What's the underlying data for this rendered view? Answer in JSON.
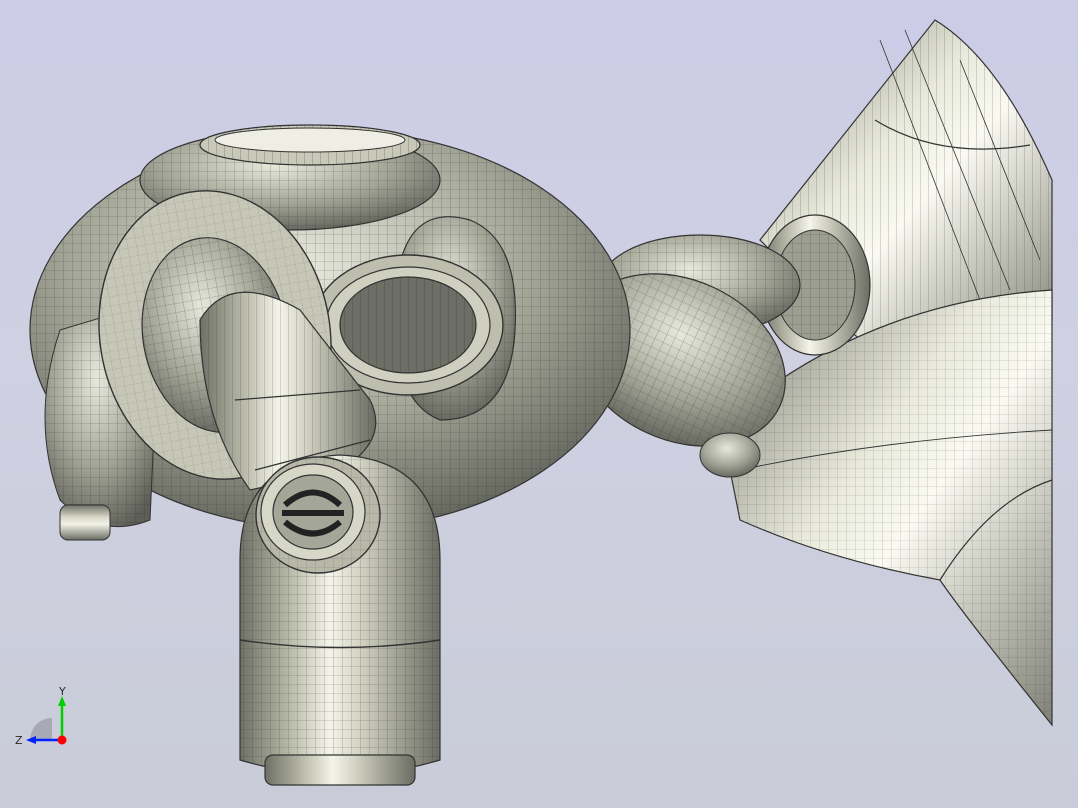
{
  "viewport": {
    "background_top": "#cccce6",
    "background_bottom": "#c9ccd8",
    "model_color": "#b4b6a6",
    "mesh_color": "#2a2a2a"
  },
  "triad": {
    "x_label": "",
    "y_label": "Y",
    "z_label": "Z",
    "x_color": "#ff0000",
    "y_color": "#00d000",
    "z_color": "#0020ff"
  }
}
